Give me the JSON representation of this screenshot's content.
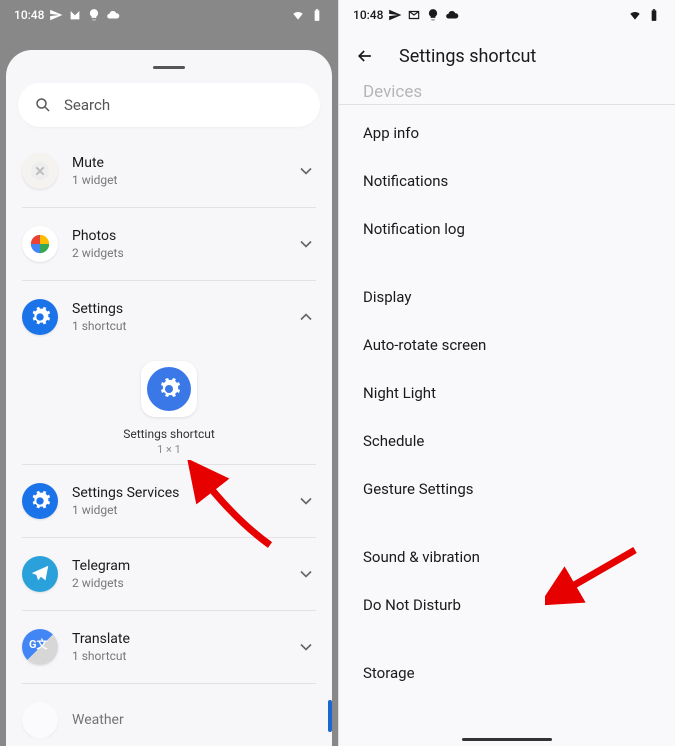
{
  "status": {
    "time": "10:48",
    "icons": [
      "send",
      "mail",
      "bulb",
      "cloud"
    ]
  },
  "left": {
    "search_placeholder": "Search",
    "rows": [
      {
        "title": "Mute",
        "sub": "1 widget",
        "icon": "mute",
        "expanded": false
      },
      {
        "title": "Photos",
        "sub": "2 widgets",
        "icon": "photos",
        "expanded": false
      },
      {
        "title": "Settings",
        "sub": "1 shortcut",
        "icon": "settings",
        "expanded": true
      },
      {
        "title": "Settings Services",
        "sub": "1 widget",
        "icon": "settings-blue",
        "expanded": false
      },
      {
        "title": "Telegram",
        "sub": "2 widgets",
        "icon": "telegram",
        "expanded": false
      },
      {
        "title": "Translate",
        "sub": "1 shortcut",
        "icon": "translate",
        "expanded": false
      },
      {
        "title": "Weather",
        "sub": "",
        "icon": "weather",
        "expanded": false
      }
    ],
    "shortcut": {
      "label": "Settings shortcut",
      "size": "1 × 1"
    }
  },
  "right": {
    "title": "Settings shortcut",
    "partial_top": "Devices",
    "items": [
      "App info",
      "Notifications",
      "Notification log",
      "",
      "Display",
      "Auto-rotate screen",
      "Night Light",
      "Schedule",
      "Gesture Settings",
      "",
      "Sound & vibration",
      "Do Not Disturb",
      "",
      "Storage"
    ]
  }
}
